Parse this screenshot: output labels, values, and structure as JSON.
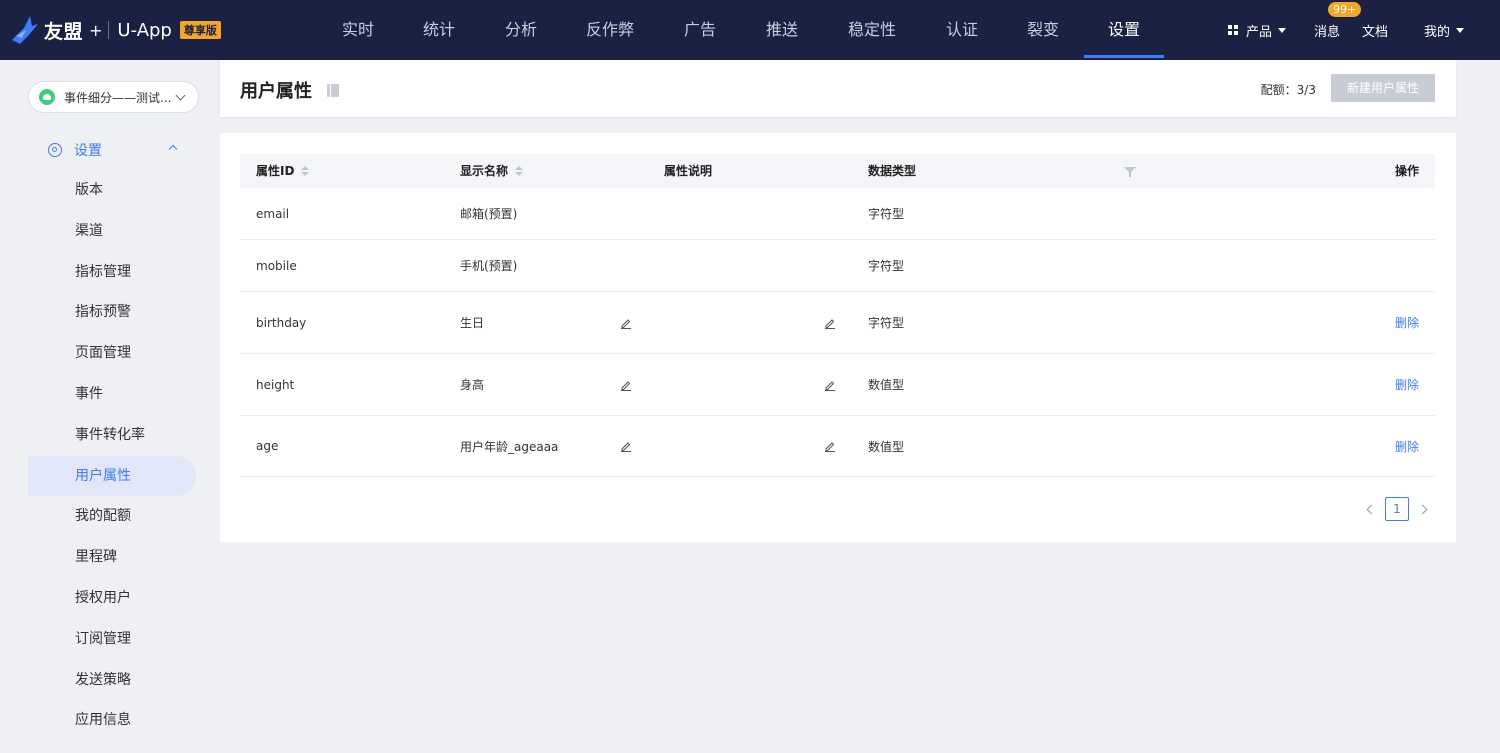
{
  "brand": {
    "name": "友盟",
    "plus": "+",
    "product": "U-App",
    "edition_badge": "尊享版"
  },
  "nav": {
    "items": [
      "实时",
      "统计",
      "分析",
      "反作弊",
      "广告",
      "推送",
      "稳定性",
      "认证",
      "裂变",
      "设置"
    ],
    "active": "设置",
    "right": {
      "products_label": "产品",
      "messages_label": "消息",
      "messages_badge": "99+",
      "docs_label": "文档",
      "mine_label": "我的"
    }
  },
  "sidebar": {
    "app_select": "事件细分——测试...",
    "section_label": "设置",
    "items": [
      "版本",
      "渠道",
      "指标管理",
      "指标预警",
      "页面管理",
      "事件",
      "事件转化率",
      "用户属性",
      "我的配额",
      "里程碑",
      "授权用户",
      "订阅管理",
      "发送策略",
      "应用信息"
    ],
    "active": "用户属性"
  },
  "header": {
    "title": "用户属性",
    "quota": "配额：3/3",
    "new_button": "新建用户属性"
  },
  "table": {
    "columns": [
      "属性ID",
      "显示名称",
      "属性说明",
      "数据类型",
      "操作"
    ],
    "rows": [
      {
        "id": "email",
        "name": "邮箱(预置)",
        "desc": "",
        "type": "字符型",
        "editable": false,
        "action": ""
      },
      {
        "id": "mobile",
        "name": "手机(预置)",
        "desc": "",
        "type": "字符型",
        "editable": false,
        "action": ""
      },
      {
        "id": "birthday",
        "name": "生日",
        "desc": "",
        "type": "字符型",
        "editable": true,
        "action": "删除"
      },
      {
        "id": "height",
        "name": "身高",
        "desc": "",
        "type": "数值型",
        "editable": true,
        "action": "删除"
      },
      {
        "id": "age",
        "name": "用户年龄_ageaaa",
        "desc": "",
        "type": "数值型",
        "editable": true,
        "action": "删除"
      }
    ]
  },
  "pagination": {
    "current": "1"
  },
  "colors": {
    "topbar": "#1a2142",
    "accent": "#3d7bff",
    "badge": "#f5a623"
  }
}
